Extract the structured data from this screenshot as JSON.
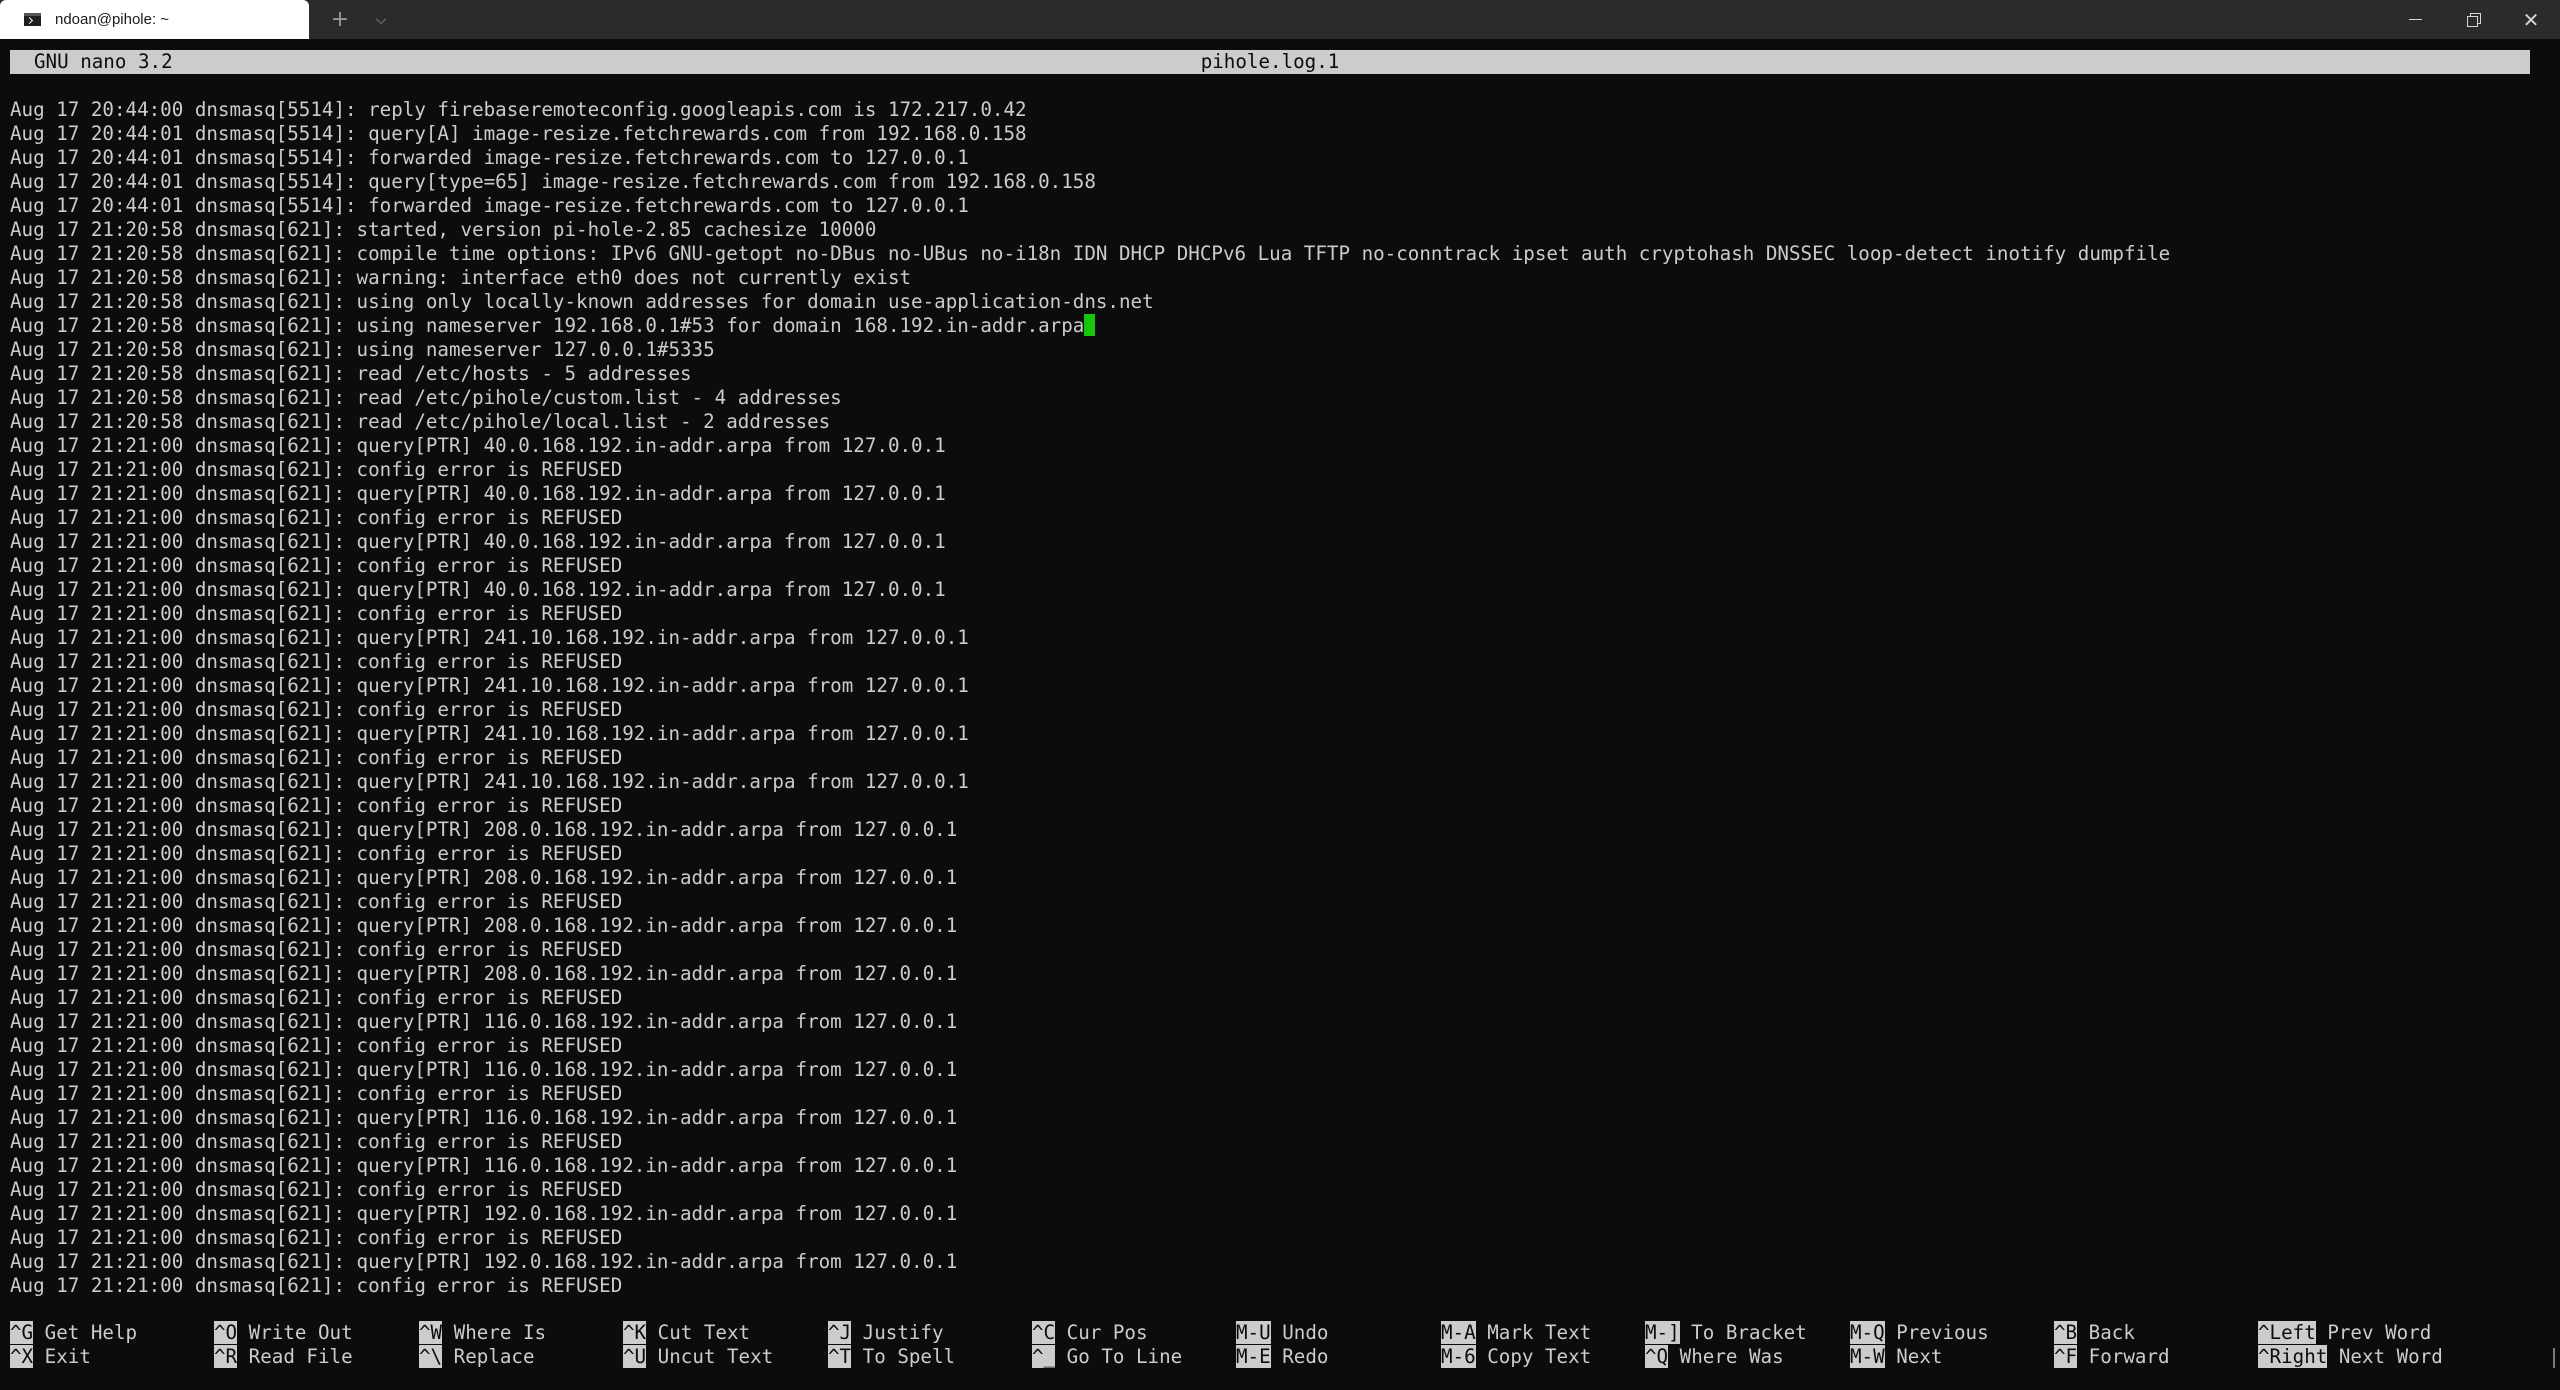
{
  "window": {
    "tab_title": "ndoan@pihole: ~",
    "new_tab_glyph": "+",
    "dropdown_glyph": "⌵"
  },
  "nano": {
    "version": "GNU nano 3.2",
    "filename": "pihole.log.1"
  },
  "log_lines": [
    "Aug 17 20:44:00 dnsmasq[5514]: reply firebaseremoteconfig.googleapis.com is 172.217.0.42",
    "Aug 17 20:44:01 dnsmasq[5514]: query[A] image-resize.fetchrewards.com from 192.168.0.158",
    "Aug 17 20:44:01 dnsmasq[5514]: forwarded image-resize.fetchrewards.com to 127.0.0.1",
    "Aug 17 20:44:01 dnsmasq[5514]: query[type=65] image-resize.fetchrewards.com from 192.168.0.158",
    "Aug 17 20:44:01 dnsmasq[5514]: forwarded image-resize.fetchrewards.com to 127.0.0.1",
    "Aug 17 21:20:58 dnsmasq[621]: started, version pi-hole-2.85 cachesize 10000",
    "Aug 17 21:20:58 dnsmasq[621]: compile time options: IPv6 GNU-getopt no-DBus no-UBus no-i18n IDN DHCP DHCPv6 Lua TFTP no-conntrack ipset auth cryptohash DNSSEC loop-detect inotify dumpfile",
    "Aug 17 21:20:58 dnsmasq[621]: warning: interface eth0 does not currently exist",
    "Aug 17 21:20:58 dnsmasq[621]: using only locally-known addresses for domain use-application-dns.net",
    "Aug 17 21:20:58 dnsmasq[621]: using nameserver 192.168.0.1#53 for domain 168.192.in-addr.arpa",
    "Aug 17 21:20:58 dnsmasq[621]: using nameserver 127.0.0.1#5335",
    "Aug 17 21:20:58 dnsmasq[621]: read /etc/hosts - 5 addresses",
    "Aug 17 21:20:58 dnsmasq[621]: read /etc/pihole/custom.list - 4 addresses",
    "Aug 17 21:20:58 dnsmasq[621]: read /etc/pihole/local.list - 2 addresses",
    "Aug 17 21:21:00 dnsmasq[621]: query[PTR] 40.0.168.192.in-addr.arpa from 127.0.0.1",
    "Aug 17 21:21:00 dnsmasq[621]: config error is REFUSED",
    "Aug 17 21:21:00 dnsmasq[621]: query[PTR] 40.0.168.192.in-addr.arpa from 127.0.0.1",
    "Aug 17 21:21:00 dnsmasq[621]: config error is REFUSED",
    "Aug 17 21:21:00 dnsmasq[621]: query[PTR] 40.0.168.192.in-addr.arpa from 127.0.0.1",
    "Aug 17 21:21:00 dnsmasq[621]: config error is REFUSED",
    "Aug 17 21:21:00 dnsmasq[621]: query[PTR] 40.0.168.192.in-addr.arpa from 127.0.0.1",
    "Aug 17 21:21:00 dnsmasq[621]: config error is REFUSED",
    "Aug 17 21:21:00 dnsmasq[621]: query[PTR] 241.10.168.192.in-addr.arpa from 127.0.0.1",
    "Aug 17 21:21:00 dnsmasq[621]: config error is REFUSED",
    "Aug 17 21:21:00 dnsmasq[621]: query[PTR] 241.10.168.192.in-addr.arpa from 127.0.0.1",
    "Aug 17 21:21:00 dnsmasq[621]: config error is REFUSED",
    "Aug 17 21:21:00 dnsmasq[621]: query[PTR] 241.10.168.192.in-addr.arpa from 127.0.0.1",
    "Aug 17 21:21:00 dnsmasq[621]: config error is REFUSED",
    "Aug 17 21:21:00 dnsmasq[621]: query[PTR] 241.10.168.192.in-addr.arpa from 127.0.0.1",
    "Aug 17 21:21:00 dnsmasq[621]: config error is REFUSED",
    "Aug 17 21:21:00 dnsmasq[621]: query[PTR] 208.0.168.192.in-addr.arpa from 127.0.0.1",
    "Aug 17 21:21:00 dnsmasq[621]: config error is REFUSED",
    "Aug 17 21:21:00 dnsmasq[621]: query[PTR] 208.0.168.192.in-addr.arpa from 127.0.0.1",
    "Aug 17 21:21:00 dnsmasq[621]: config error is REFUSED",
    "Aug 17 21:21:00 dnsmasq[621]: query[PTR] 208.0.168.192.in-addr.arpa from 127.0.0.1",
    "Aug 17 21:21:00 dnsmasq[621]: config error is REFUSED",
    "Aug 17 21:21:00 dnsmasq[621]: query[PTR] 208.0.168.192.in-addr.arpa from 127.0.0.1",
    "Aug 17 21:21:00 dnsmasq[621]: config error is REFUSED",
    "Aug 17 21:21:00 dnsmasq[621]: query[PTR] 116.0.168.192.in-addr.arpa from 127.0.0.1",
    "Aug 17 21:21:00 dnsmasq[621]: config error is REFUSED",
    "Aug 17 21:21:00 dnsmasq[621]: query[PTR] 116.0.168.192.in-addr.arpa from 127.0.0.1",
    "Aug 17 21:21:00 dnsmasq[621]: config error is REFUSED",
    "Aug 17 21:21:00 dnsmasq[621]: query[PTR] 116.0.168.192.in-addr.arpa from 127.0.0.1",
    "Aug 17 21:21:00 dnsmasq[621]: config error is REFUSED",
    "Aug 17 21:21:00 dnsmasq[621]: query[PTR] 116.0.168.192.in-addr.arpa from 127.0.0.1",
    "Aug 17 21:21:00 dnsmasq[621]: config error is REFUSED",
    "Aug 17 21:21:00 dnsmasq[621]: query[PTR] 192.0.168.192.in-addr.arpa from 127.0.0.1",
    "Aug 17 21:21:00 dnsmasq[621]: config error is REFUSED",
    "Aug 17 21:21:00 dnsmasq[621]: query[PTR] 192.0.168.192.in-addr.arpa from 127.0.0.1",
    "Aug 17 21:21:00 dnsmasq[621]: config error is REFUSED"
  ],
  "cursor_line": 9,
  "cursor_color": "#16c60c",
  "shortcuts": [
    {
      "top_key": "^G",
      "top_label": "Get Help",
      "bottom_key": "^X",
      "bottom_label": "Exit"
    },
    {
      "top_key": "^O",
      "top_label": "Write Out",
      "bottom_key": "^R",
      "bottom_label": "Read File"
    },
    {
      "top_key": "^W",
      "top_label": "Where Is",
      "bottom_key": "^\\",
      "bottom_label": "Replace"
    },
    {
      "top_key": "^K",
      "top_label": "Cut Text",
      "bottom_key": "^U",
      "bottom_label": "Uncut Text"
    },
    {
      "top_key": "^J",
      "top_label": "Justify",
      "bottom_key": "^T",
      "bottom_label": "To Spell"
    },
    {
      "top_key": "^C",
      "top_label": "Cur Pos",
      "bottom_key": "^_",
      "bottom_label": "Go To Line"
    },
    {
      "top_key": "M-U",
      "top_label": "Undo",
      "bottom_key": "M-E",
      "bottom_label": "Redo"
    },
    {
      "top_key": "M-A",
      "top_label": "Mark Text",
      "bottom_key": "M-6",
      "bottom_label": "Copy Text"
    },
    {
      "top_key": "M-]",
      "top_label": "To Bracket",
      "bottom_key": "^Q",
      "bottom_label": "Where Was"
    },
    {
      "top_key": "M-Q",
      "top_label": "Previous",
      "bottom_key": "M-W",
      "bottom_label": "Next"
    },
    {
      "top_key": "^B",
      "top_label": "Back",
      "bottom_key": "^F",
      "bottom_label": "Forward"
    },
    {
      "top_key": "^Left",
      "top_label": "Prev Word",
      "bottom_key": "^Right",
      "bottom_label": "Next Word"
    }
  ]
}
